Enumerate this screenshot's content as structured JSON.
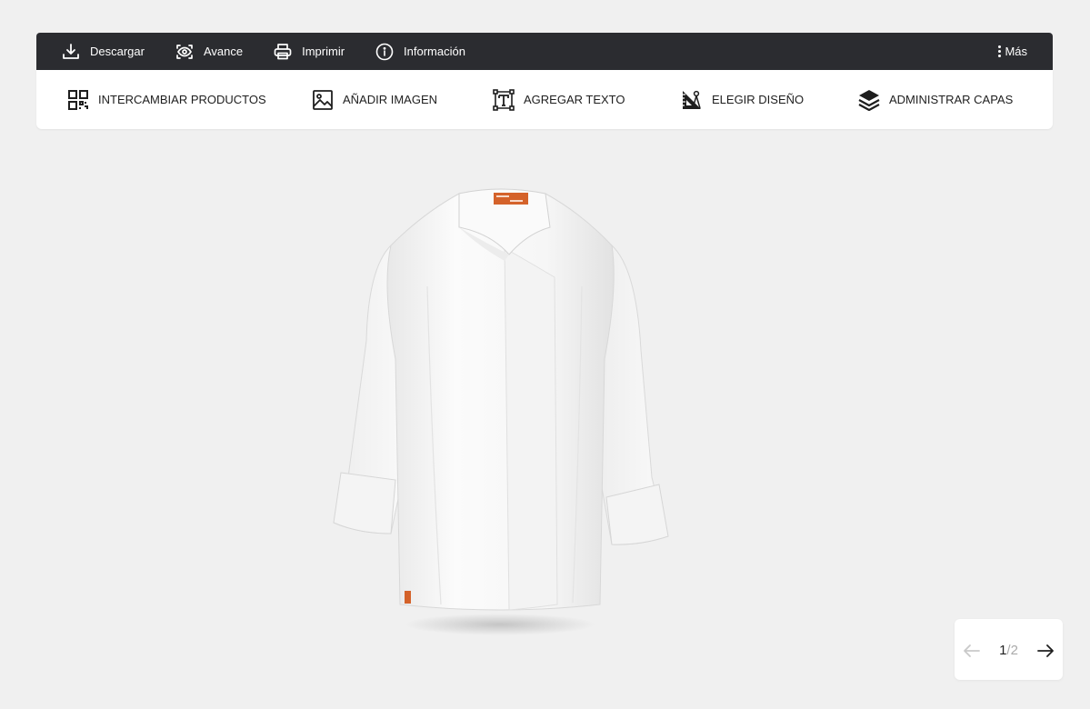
{
  "topbar": {
    "download_label": "Descargar",
    "preview_label": "Avance",
    "print_label": "Imprimir",
    "info_label": "Información",
    "more_label": "Más"
  },
  "toolbar": {
    "swap_products_label": "INTERCAMBIAR PRODUCTOS",
    "add_image_label": "AÑADIR IMAGEN",
    "add_text_label": "AGREGAR TEXTO",
    "choose_design_label": "ELEGIR DISEÑO",
    "manage_layers_label": "ADMINISTRAR CAPAS"
  },
  "product": {
    "icon": "chef-jacket-image",
    "color": "#ffffff"
  },
  "pager": {
    "current": "1",
    "separator": "/",
    "total": "2"
  },
  "colors": {
    "background": "#f0f0f0",
    "topbar": "#2b2c30",
    "toolbar": "#ffffff",
    "tag_orange": "#d4622a"
  }
}
